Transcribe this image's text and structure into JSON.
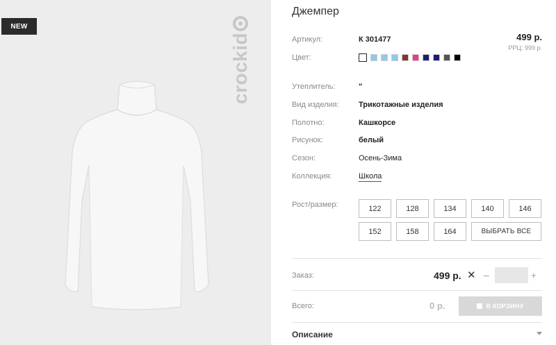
{
  "photo": {
    "badge": "NEW",
    "brand": "crockid"
  },
  "product": {
    "title": "Джемпер",
    "price": "499 р.",
    "rrp": "РРЦ: 999 р."
  },
  "attributes": [
    {
      "label": "Артикул:",
      "value": "К 301477"
    },
    {
      "label": "Цвет:",
      "value": ""
    },
    {
      "label": "Утеплитель:",
      "value": "\""
    },
    {
      "label": "Вид изделия:",
      "value": "Трикотажные изделия"
    },
    {
      "label": "Полотно:",
      "value": "Кашкорсе"
    },
    {
      "label": "Рисунок:",
      "value": "белый"
    },
    {
      "label": "Сезон:",
      "value": "Осень-Зима"
    },
    {
      "label": "Коллекция:",
      "value": "Школа"
    }
  ],
  "colors": [
    "#ffffff",
    "#8ec9f0",
    "#8ec9f0",
    "#8ec9f0",
    "#7a3b2a",
    "#e83e8c",
    "#1c1c7a",
    "#1c1c7a",
    "#555555",
    "#000000"
  ],
  "sizes": {
    "label": "Рост/размер:",
    "options": [
      "122",
      "128",
      "134",
      "140",
      "146",
      "152",
      "158",
      "164"
    ],
    "select_all": "ВЫБРАТЬ ВСЕ"
  },
  "order": {
    "label": "Заказ:",
    "price": "499 р.",
    "times": "✕",
    "minus": "–",
    "plus": "+",
    "quantity": ""
  },
  "total": {
    "label": "Всего:",
    "value": "0 р.",
    "cart_button": "В КОРЗИНУ"
  },
  "description": {
    "label": "Описание"
  }
}
